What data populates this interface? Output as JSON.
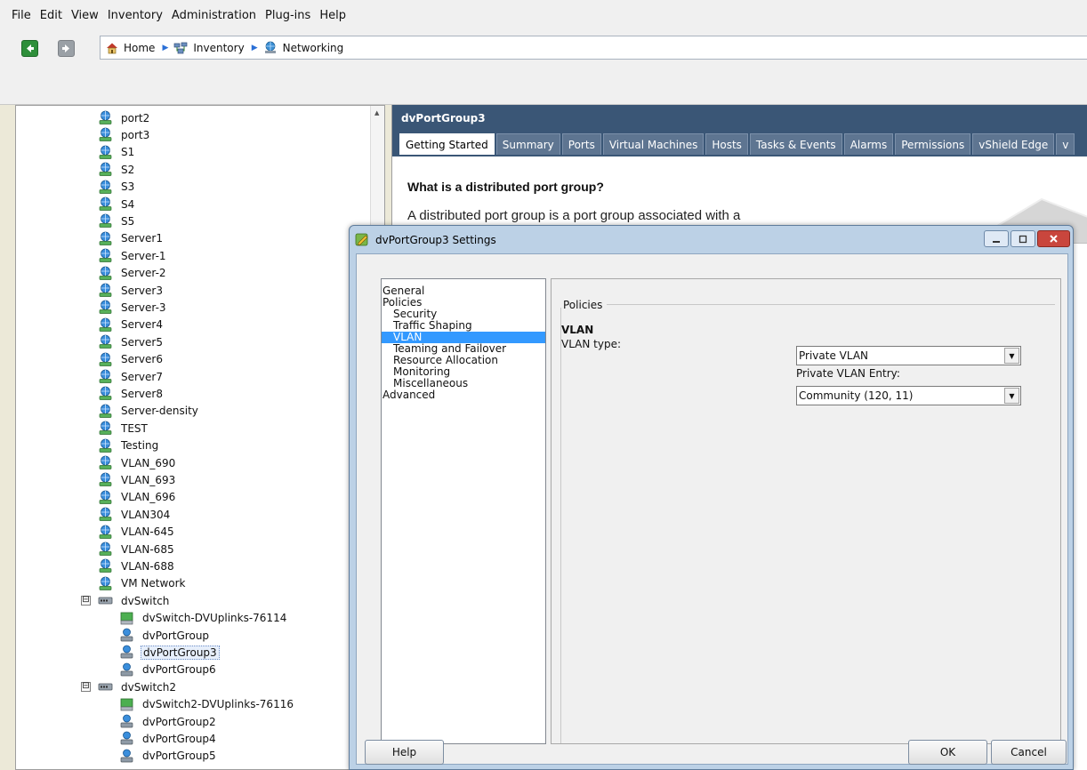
{
  "menu": [
    "File",
    "Edit",
    "View",
    "Inventory",
    "Administration",
    "Plug-ins",
    "Help"
  ],
  "breadcrumb": [
    "Home",
    "Inventory",
    "Networking"
  ],
  "tree": {
    "networks": [
      "port2",
      "port3",
      "S1",
      "S2",
      "S3",
      "S4",
      "S5",
      "Server1",
      "Server-1",
      "Server-2",
      "Server3",
      "Server-3",
      "Server4",
      "Server5",
      "Server6",
      "Server7",
      "Server8",
      "Server-density",
      "TEST",
      "Testing",
      "VLAN_690",
      "VLAN_693",
      "VLAN_696",
      "VLAN304",
      "VLAN-645",
      "VLAN-685",
      "VLAN-688",
      "VM Network"
    ],
    "switches": [
      {
        "name": "dvSwitch",
        "children": [
          "dvSwitch-DVUplinks-76114",
          "dvPortGroup",
          "dvPortGroup3",
          "dvPortGroup6"
        ]
      },
      {
        "name": "dvSwitch2",
        "children": [
          "dvSwitch2-DVUplinks-76116",
          "dvPortGroup2",
          "dvPortGroup4",
          "dvPortGroup5"
        ]
      }
    ],
    "selected": "dvPortGroup3",
    "toggle_symbol": "⊟"
  },
  "content": {
    "title": "dvPortGroup3",
    "tabs": [
      "Getting Started",
      "Summary",
      "Ports",
      "Virtual Machines",
      "Hosts",
      "Tasks & Events",
      "Alarms",
      "Permissions",
      "vShield Edge",
      "v"
    ],
    "active_tab": "Getting Started",
    "heading": "What is a distributed port group?",
    "text": "A distributed port group is a port group associated with a"
  },
  "dialog": {
    "title": "dvPortGroup3 Settings",
    "nav": [
      {
        "label": "General",
        "level": 0
      },
      {
        "label": "Policies",
        "level": 0
      },
      {
        "label": "Security",
        "level": 1
      },
      {
        "label": "Traffic Shaping",
        "level": 1
      },
      {
        "label": "VLAN",
        "level": 1,
        "selected": true
      },
      {
        "label": "Teaming and Failover",
        "level": 1
      },
      {
        "label": "Resource Allocation",
        "level": 1
      },
      {
        "label": "Monitoring",
        "level": 1
      },
      {
        "label": "Miscellaneous",
        "level": 1
      },
      {
        "label": "Advanced",
        "level": 0
      }
    ],
    "group_label": "Policies",
    "section_heading": "VLAN",
    "vlan_type_label": "VLAN type:",
    "vlan_type_value": "Private VLAN",
    "pvlan_entry_label": "Private VLAN Entry:",
    "pvlan_entry_value": "Community (120, 11)",
    "buttons": {
      "help": "Help",
      "ok": "OK",
      "cancel": "Cancel"
    }
  },
  "colors": {
    "header_bg": "#3a5676",
    "selection": "#3399ff",
    "close_button": "#c9463d"
  }
}
